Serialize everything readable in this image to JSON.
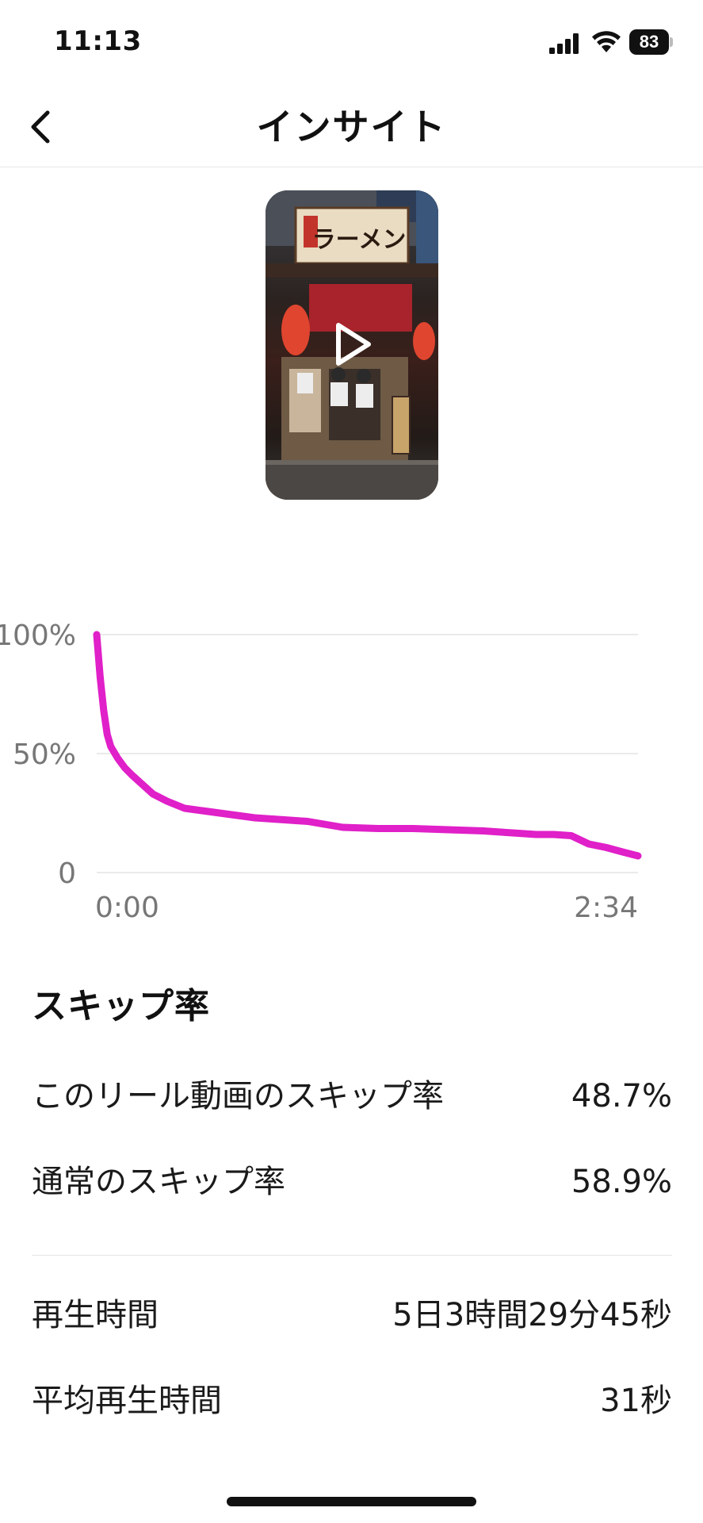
{
  "status_bar": {
    "time": "11:13",
    "battery": "83"
  },
  "header": {
    "title": "インサイト",
    "back_icon": "chevron-left-icon"
  },
  "video": {
    "sign_text": "ラーメン",
    "play_icon": "play-icon"
  },
  "chart_data": {
    "type": "line",
    "ytick_labels": [
      "100%",
      "50%",
      "0"
    ],
    "yticks": [
      100,
      50,
      0
    ],
    "xtick_labels": [
      "0:00",
      "2:34"
    ],
    "xlim": [
      0,
      154
    ],
    "ylim": [
      0,
      100
    ],
    "grid": true,
    "series_color": "#e020c8",
    "series": [
      {
        "x": [
          0,
          1,
          2,
          3,
          4,
          6,
          8,
          10,
          13,
          16,
          20,
          25,
          30,
          35,
          40,
          45,
          50,
          55,
          60,
          70,
          80,
          90,
          100,
          110,
          115,
          120,
          125,
          130,
          135,
          140,
          145,
          150,
          154
        ],
        "values": [
          100,
          82,
          68,
          58,
          53,
          48,
          44,
          41,
          37,
          33,
          30,
          27,
          26,
          25,
          24,
          23,
          22.5,
          22,
          21.5,
          19,
          18.5,
          18.5,
          18,
          17.5,
          17,
          16.5,
          16,
          16,
          15.5,
          12,
          10.5,
          8.5,
          7
        ]
      }
    ]
  },
  "skip_rate": {
    "title": "スキップ率",
    "reel_label": "このリール動画のスキップ率",
    "reel_value": "48.7%",
    "normal_label": "通常のスキップ率",
    "normal_value": "58.9%"
  },
  "playback": {
    "play_time_label": "再生時間",
    "play_time_value": "5日3時間29分45秒",
    "avg_label": "平均再生時間",
    "avg_value": "31秒"
  }
}
